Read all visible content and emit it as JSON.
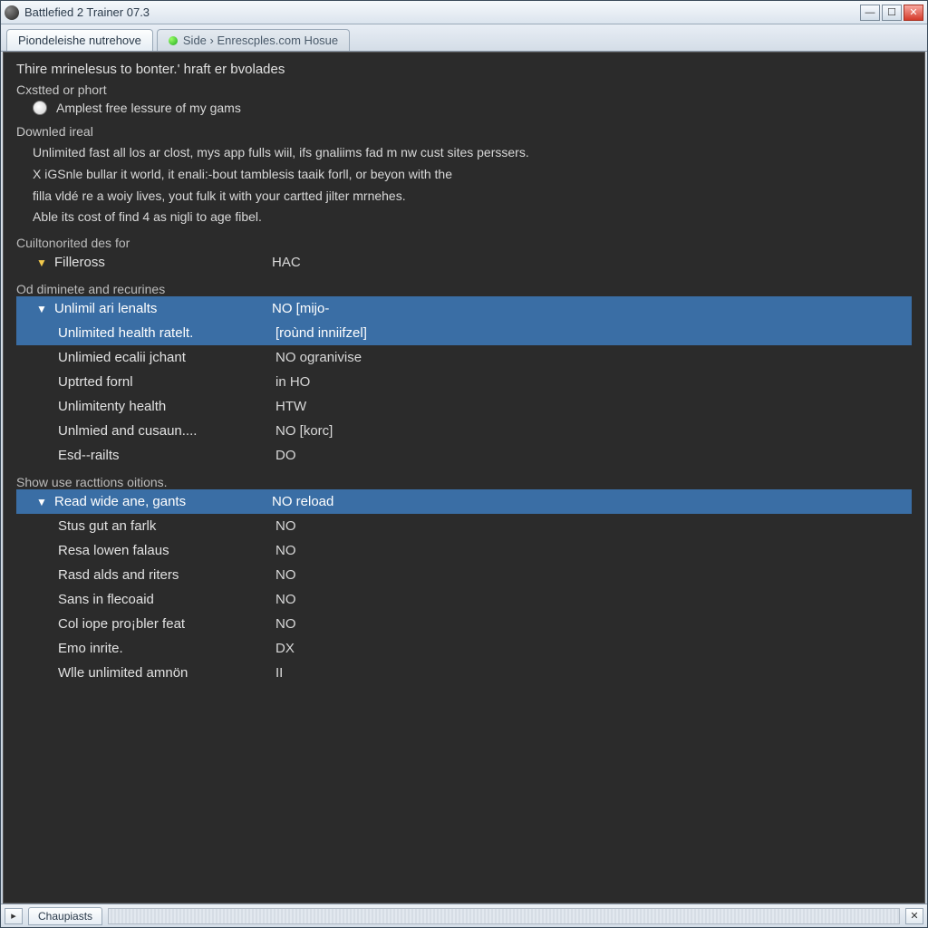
{
  "window": {
    "title": "Battlefied 2 Trainer 07.3"
  },
  "tabs": [
    {
      "label": "Piondeleishe nutrehove",
      "active": true
    },
    {
      "label": "Side › Enrescples.com Hosue",
      "active": false
    }
  ],
  "intro": {
    "heading": "Thire mrinelesus to bonter.' hraft er bvolades",
    "sub1": "Cxstted or phort",
    "radio_label": "Amplest free lessure of my gams",
    "sub2": "Downled ireal",
    "lines": [
      "Unlimited fast all los ar clost, mys app fulls wiil, ifs gnaliims fad m nw cust sites perssers.",
      "X iGSnle bullar it world, it enali:-bout tamblesis taaik forll, or beyon with the",
      "filla vldé re a woiy lives, yout fulk it with your cartted jilter mrnehes.",
      "Able its cost of find 4 as nigli to age fibel."
    ]
  },
  "section1": {
    "label": "Cuiltonorited des for",
    "root": {
      "name": "Filleross",
      "value": "HAC"
    }
  },
  "section2": {
    "label": "Od diminete and recurines",
    "root": {
      "name": "Unlimil ari lenalts",
      "value": "NO  [mijo-",
      "selected": true
    },
    "children": [
      {
        "name": "Unlimited health ratelt.",
        "value": "[roùnd inniifzel]",
        "selected": true
      },
      {
        "name": "Unlimied ecalii jchant",
        "value": "NO ogranivise"
      },
      {
        "name": "Uptrted fornl",
        "value": "in HO"
      },
      {
        "name": "Unlimitenty health",
        "value": "HTW"
      },
      {
        "name": "Unlmied and cusaun....",
        "value": "NO  [korc]"
      },
      {
        "name": "Esd--railts",
        "value": "DO"
      }
    ]
  },
  "section3": {
    "label": "Show use racttions oitions.",
    "root": {
      "name": "Read wide ane, gants",
      "value": "NO reload",
      "selected": true
    },
    "children": [
      {
        "name": "Stus gut an farlk",
        "value": "NO"
      },
      {
        "name": "Resa lowen falaus",
        "value": "NO"
      },
      {
        "name": "Rasd alds and riters",
        "value": "NO"
      },
      {
        "name": "Sans in flecoaid",
        "value": "NO"
      },
      {
        "name": "Col iope pro¡bler feat",
        "value": "NO"
      },
      {
        "name": "Emo inrite.",
        "value": "DX"
      },
      {
        "name": "Wlle unlimited amnön",
        "value": "II"
      }
    ]
  },
  "statusbar": {
    "tab": "Chaupiasts"
  },
  "icons": {
    "minimize": "—",
    "maximize": "☐",
    "close": "✕",
    "arrow_down": "▼",
    "arrow_right": "▸"
  }
}
